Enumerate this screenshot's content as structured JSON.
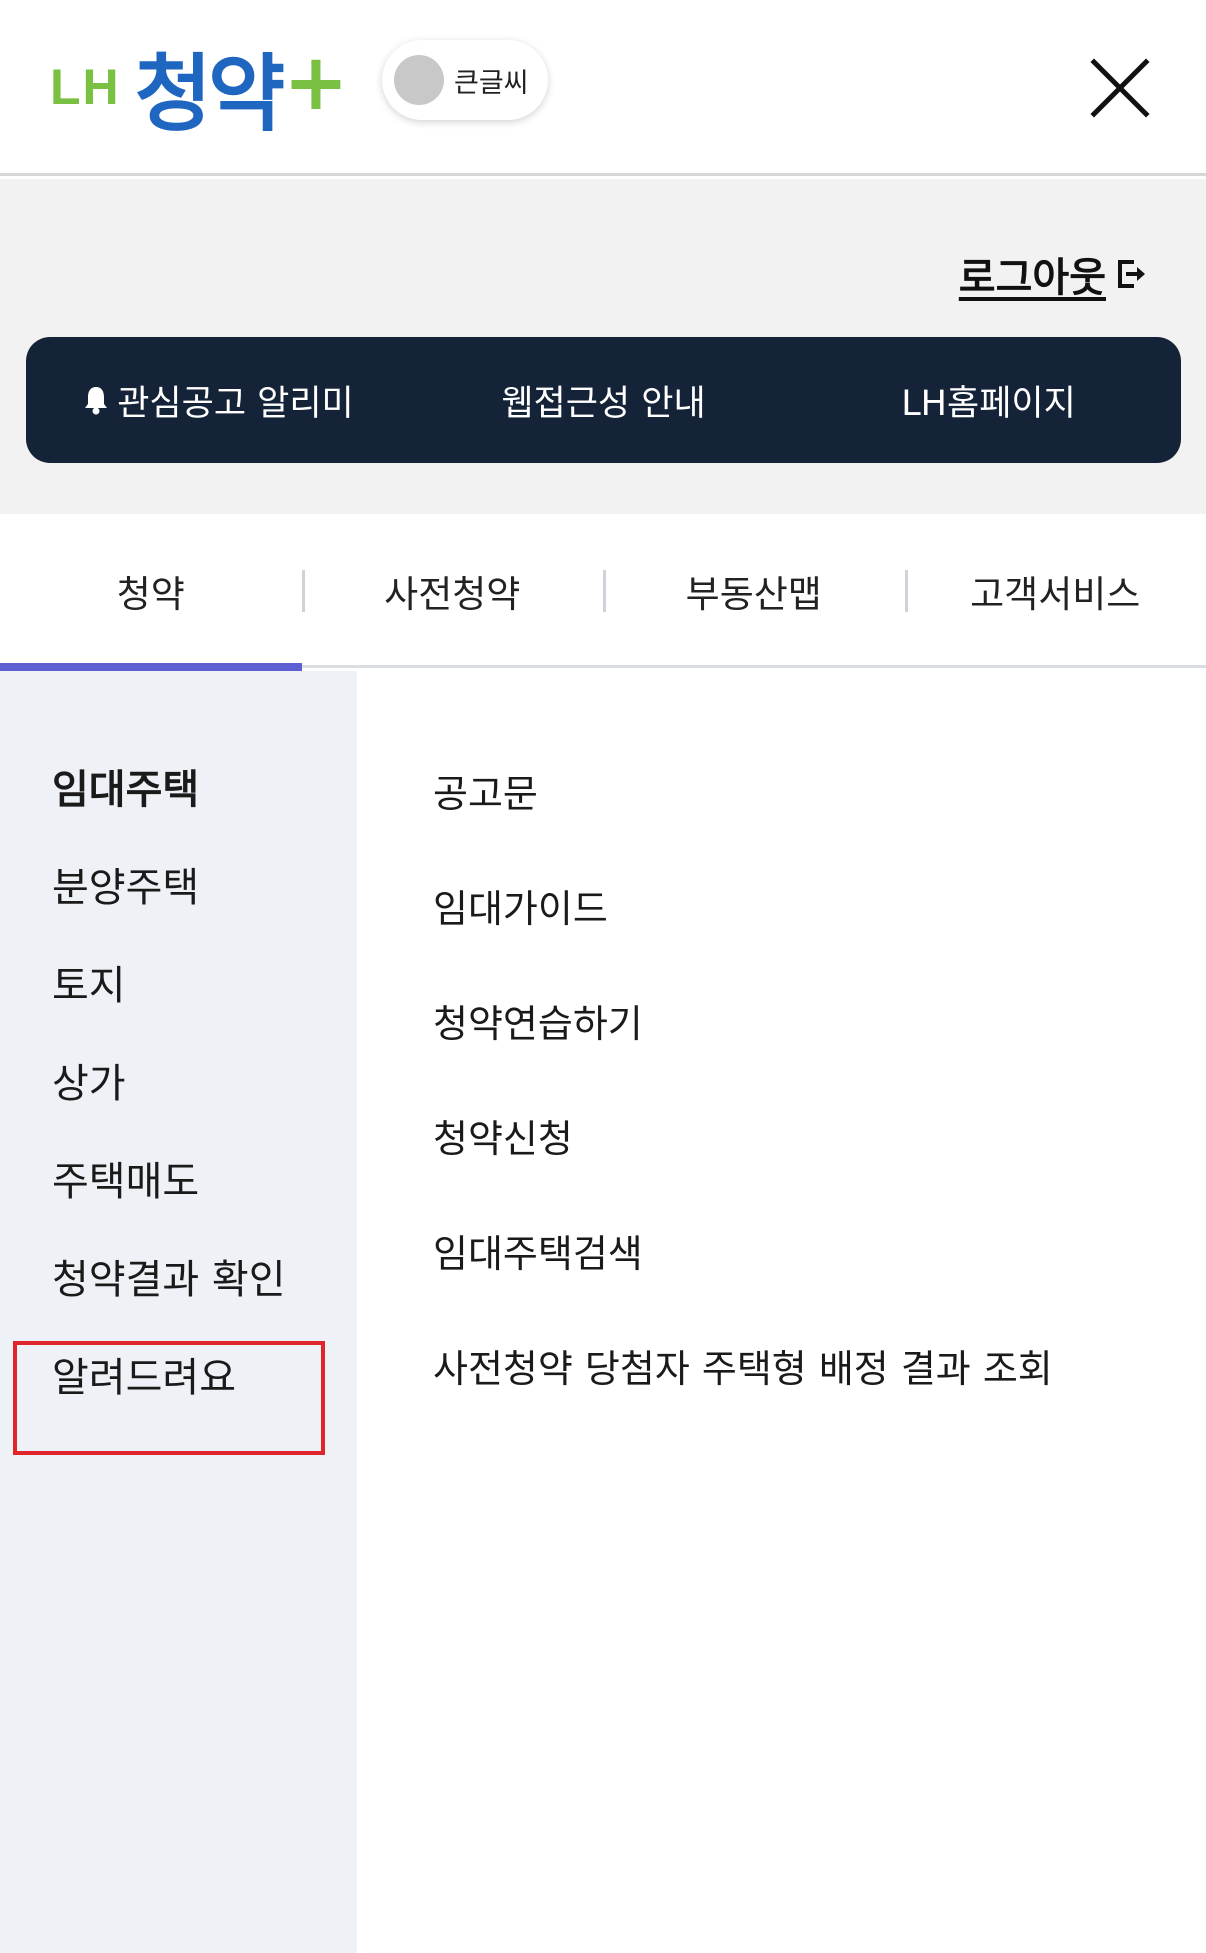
{
  "header": {
    "logo": {
      "lh": "LH",
      "main": "청약",
      "plus": "+"
    },
    "font_toggle_label": "큰글씨"
  },
  "top": {
    "logout_label": "로그아웃",
    "quick_links": [
      "관심공고 알리미",
      "웹접근성 안내",
      "LH홈페이지"
    ]
  },
  "tabs": [
    "청약",
    "사전청약",
    "부동산맵",
    "고객서비스"
  ],
  "active_tab": 0,
  "left_menu": [
    "임대주택",
    "분양주택",
    "토지",
    "상가",
    "주택매도",
    "청약결과 확인",
    "알려드려요"
  ],
  "right_menu": [
    "공고문",
    "임대가이드",
    "청약연습하기",
    "청약신청",
    "임대주택검색",
    "사전청약 당첨자 주택형 배정 결과 조회"
  ],
  "colors": {
    "brand_blue": "#1f66c1",
    "brand_green": "#7ac143",
    "quick_bar_bg": "#152338",
    "active_tab_bar": "#5b5fd1",
    "highlight_border": "#e0242b"
  }
}
